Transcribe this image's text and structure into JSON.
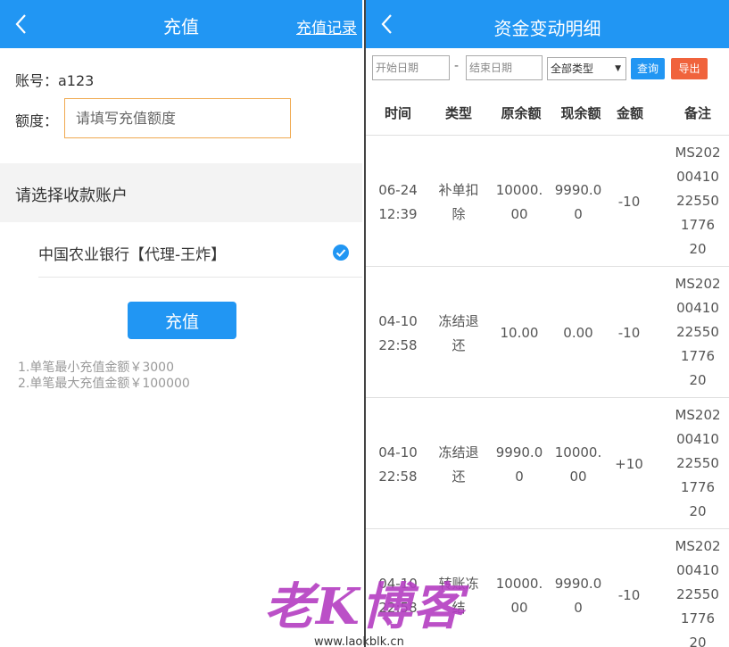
{
  "left": {
    "title": "充值",
    "record_link": "充值记录",
    "account": "账号：a123",
    "amount_label": "额度：",
    "amount_placeholder": "请填写充值额度",
    "section_title": "请选择收款账户",
    "bank_name": "中国农业银行【代理-王炸】",
    "recharge_button": "充值",
    "notes": [
      "1.单笔最小充值金额￥3000",
      "2.单笔最大充值金额￥100000"
    ]
  },
  "right": {
    "title": "资金变动明细",
    "filter": {
      "start_placeholder": "开始日期",
      "separator": "-",
      "end_placeholder": "结束日期",
      "type_selected": "全部类型",
      "query_label": "查询",
      "export_label": "导出"
    },
    "columns": [
      "时间",
      "类型",
      "原余额",
      "现余额",
      "金额",
      "备注"
    ],
    "rows": [
      {
        "time": "06-24 12:39",
        "type": "补单扣除",
        "old": "10000.00",
        "new": "9990.00",
        "amount": "-10",
        "note": "MS20200410225501776 20"
      },
      {
        "time": "04-10 22:58",
        "type": "冻结退还",
        "old": "10.00",
        "new": "0.00",
        "amount": "-10",
        "note": "MS20200410225501776 20"
      },
      {
        "time": "04-10 22:58",
        "type": "冻结退还",
        "old": "9990.00",
        "new": "10000.00",
        "amount": "+10",
        "note": "MS20200410225501776 20"
      },
      {
        "time": "04-10 22:58",
        "type": "转账冻结",
        "old": "10000.00",
        "new": "9990.00",
        "amount": "-10",
        "note": "MS20200410225501776 20"
      }
    ]
  },
  "watermark": {
    "text": "老K博客",
    "url": "www.laokblk.cn"
  },
  "colors": {
    "brand": "#2196f3",
    "export": "#f0633c",
    "input_border": "#f0a94f",
    "watermark": "#b43ec2"
  }
}
